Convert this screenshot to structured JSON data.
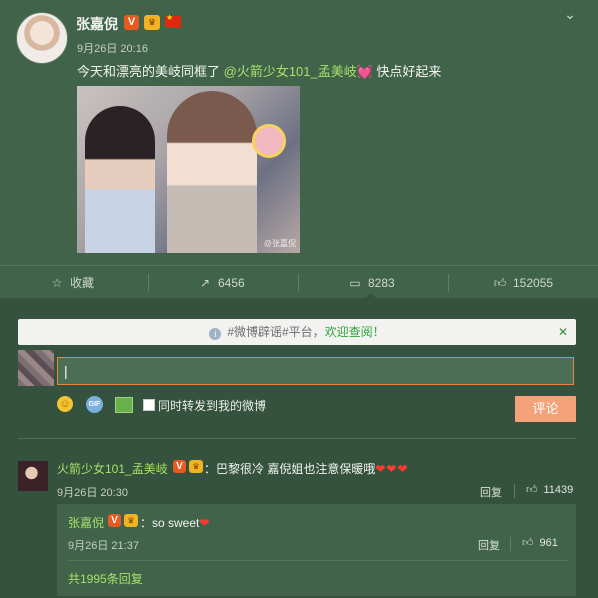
{
  "post": {
    "author": "张嘉倪",
    "verified_badge": "V",
    "time": "9月26日 20:16",
    "text_before": "今天和漂亮的美岐同框了 ",
    "mention": "@火箭少女101_孟美岐",
    "text_after": " 快点好起来",
    "photo_watermark": "@张嘉倪"
  },
  "actions": {
    "favorite": "收藏",
    "forward_count": "6456",
    "comment_count": "8283",
    "like_count": "152055"
  },
  "notice": {
    "text": "#微博辟谣#平台，",
    "link": "欢迎查阅！"
  },
  "composer": {
    "input_value": "|",
    "forward_label": "同时转发到我的微博",
    "submit_label": "评论"
  },
  "comments": [
    {
      "author": "火箭少女101_孟美岐",
      "text": "：巴黎很冷 嘉倪姐也注意保暖哦",
      "hearts": "❤❤❤",
      "time": "9月26日 20:30",
      "reply_label": "回复",
      "likes": "11439",
      "replies": [
        {
          "author": "张嘉倪",
          "text": "：so sweet",
          "hearts": "❤",
          "time": "9月26日 21:37",
          "reply_label": "回复",
          "likes": "961"
        }
      ],
      "total_replies": "共1995条回复"
    }
  ],
  "icons": {
    "favorite": "star-icon",
    "forward": "forward-icon",
    "comment": "comment-icon",
    "like": "thumbs-up-icon",
    "expand": "chevron-down-icon"
  },
  "colors": {
    "background": "#40634a",
    "comment_bg": "#34523d",
    "accent_green": "#a8e06a",
    "submit": "#f5a27b",
    "input_border": "#e6883c"
  }
}
